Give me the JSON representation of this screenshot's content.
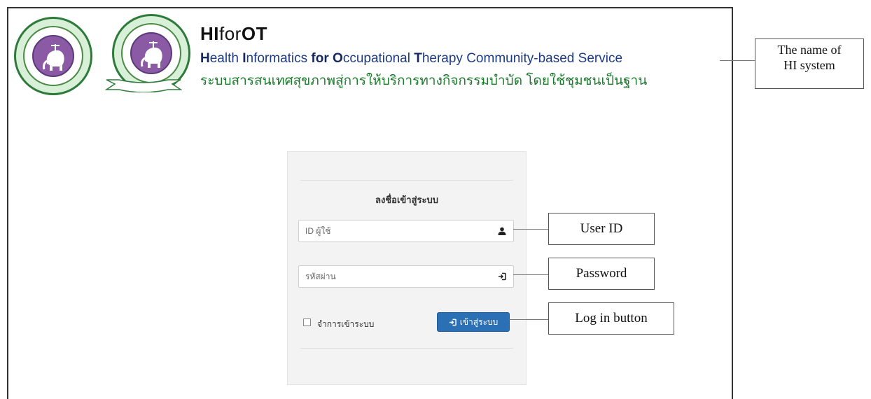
{
  "header": {
    "title_hi": "HI",
    "title_for": "for",
    "title_ot": "OT",
    "subtitle_letter_h": "H",
    "subtitle_ealth": "ealth ",
    "subtitle_letter_i": "I",
    "subtitle_nformatics": "nformatics ",
    "subtitle_for": "for",
    "subtitle_space": " ",
    "subtitle_letter_o": "O",
    "subtitle_ccupational": "ccupational ",
    "subtitle_letter_t": "T",
    "subtitle_rest": "herapy Community-based Service",
    "thai_title": "ระบบสารสนเทศสุขภาพสู่การให้บริการทางกิจกรรมบำบัด โดยใช้ชุมชนเป็นฐาน",
    "logos": [
      "university-seal",
      "faculty-seal"
    ]
  },
  "login": {
    "heading": "ลงชื่อเข้าสู่ระบบ",
    "user_placeholder": "ID ผู้ใช้",
    "password_placeholder": "รหัสผ่าน",
    "remember_label": "จำการเข้าระบบ",
    "remember_checked": false,
    "button_label": "เข้าสู่ระบบ",
    "button_color": "#2b6fb4",
    "user_icon": "user-icon",
    "password_icon": "sign-in-icon",
    "button_icon": "sign-in-icon"
  },
  "annotations": {
    "system_name_line1": "The name of",
    "system_name_line2": "HI system",
    "user_id": "User ID",
    "password": "Password",
    "login_button": "Log in button"
  },
  "colors": {
    "subtitle": "#1c3b84",
    "thai_title": "#1b7a2c",
    "panel_bg": "#f3f3f3",
    "seal_purple": "#8a5aa5"
  }
}
